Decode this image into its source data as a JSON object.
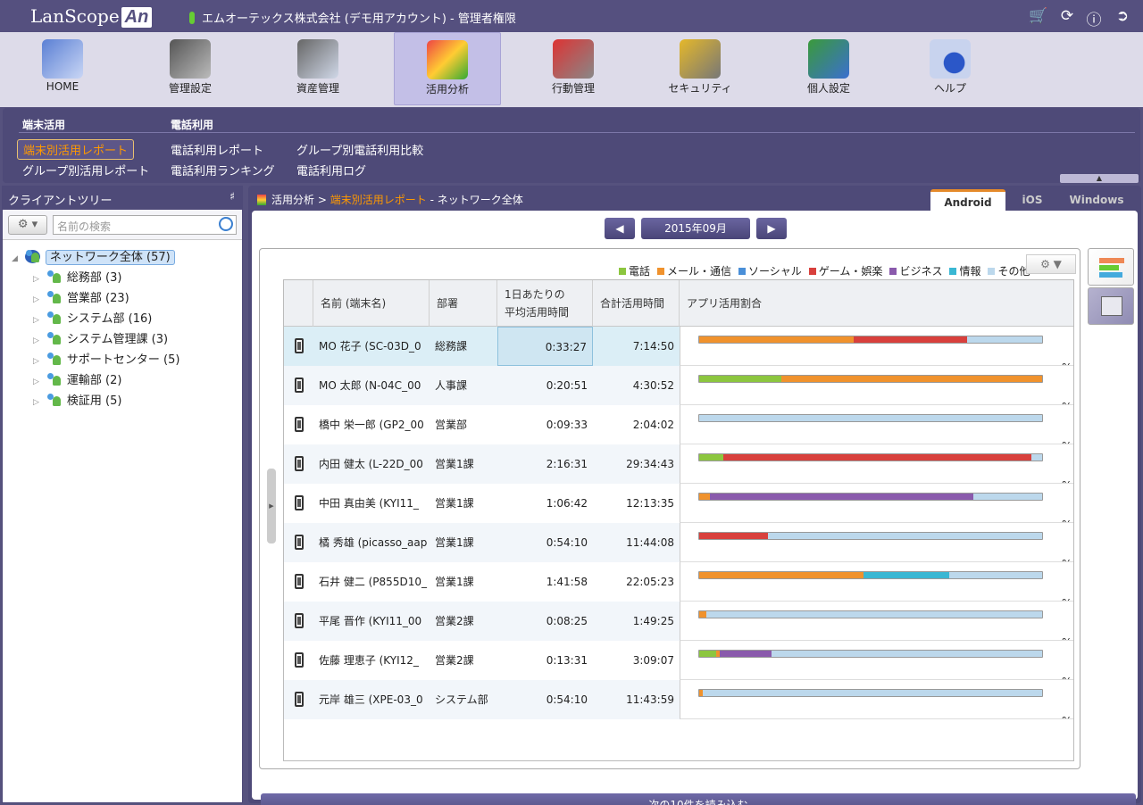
{
  "header": {
    "logo_text": "LanScope",
    "logo_badge": "An",
    "company": "エムオーテックス株式会社 (デモ用アカウント) - 管理者権限",
    "icons": [
      "cart-icon",
      "refresh-icon",
      "info-icon",
      "logout-icon"
    ]
  },
  "nav": [
    {
      "label": "HOME",
      "icon": "home-icon"
    },
    {
      "label": "管理設定",
      "icon": "settings-device-icon"
    },
    {
      "label": "資産管理",
      "icon": "asset-search-icon"
    },
    {
      "label": "活用分析",
      "icon": "analytics-icon",
      "active": true
    },
    {
      "label": "行動管理",
      "icon": "location-pin-icon"
    },
    {
      "label": "セキュリティ",
      "icon": "lock-icon"
    },
    {
      "label": "個人設定",
      "icon": "user-icon"
    },
    {
      "label": "ヘルプ",
      "icon": "help-icon"
    }
  ],
  "subnav": {
    "group1_title": "端末活用",
    "group1_links": [
      "端末別活用レポート",
      "グループ別活用レポート"
    ],
    "group2_title": "電話利用",
    "group2_links": [
      "電話利用レポート",
      "電話利用ランキング"
    ],
    "group3_links": [
      "グループ別電話利用比較",
      "電話利用ログ"
    ],
    "collapse_icon": "collapse-up-icon"
  },
  "tree": {
    "title": "クライアントツリー",
    "pin_icon": "pin-icon",
    "search_placeholder": "名前の検索",
    "root": "ネットワーク全体 (57)",
    "children": [
      "総務部 (3)",
      "営業部 (23)",
      "システム部 (16)",
      "システム管理課 (3)",
      "サポートセンター (5)",
      "運輸部 (2)",
      "検証用 (5)"
    ]
  },
  "breadcrumb": {
    "part1": "活用分析",
    "sep": ">",
    "current": "端末別活用レポート",
    "dash": "-",
    "scope": "ネットワーク全体"
  },
  "os_tabs": {
    "android": "Android",
    "ios": "iOS",
    "windows": "Windows",
    "active": "Android"
  },
  "month": {
    "prev_icon": "prev-month-icon",
    "label": "2015年09月",
    "next_icon": "next-month-icon"
  },
  "legend": [
    {
      "label": "電話",
      "color": "#8cc63f"
    },
    {
      "label": "メール・通信",
      "color": "#f0922d"
    },
    {
      "label": "ソーシャル",
      "color": "#4a8fd8"
    },
    {
      "label": "ゲーム・娯楽",
      "color": "#d8403c"
    },
    {
      "label": "ビジネス",
      "color": "#8a5aac"
    },
    {
      "label": "情報",
      "color": "#3ab7d3"
    },
    {
      "label": "その他",
      "color": "#bcd8ec"
    }
  ],
  "table": {
    "headers": {
      "name": "名前 (端末名)",
      "dept": "部署",
      "avg_line1": "1日あたりの",
      "avg_line2": "平均活用時間",
      "total": "合計活用時間",
      "ratio": "アプリ活用割合"
    },
    "axis_ticks": [
      "0",
      "10",
      "20",
      "30",
      "40",
      "50",
      "60",
      "70",
      "80",
      "90",
      "100"
    ],
    "percent_label": "%",
    "rows": [
      {
        "name": "MO 花子 (SC-03D_0",
        "dept": "総務課",
        "avg": "0:33:27",
        "total": "7:14:50",
        "ratio": [
          0,
          45,
          0,
          33,
          0,
          0,
          22
        ]
      },
      {
        "name": "MO 太郎 (N-04C_00",
        "dept": "人事課",
        "avg": "0:20:51",
        "total": "4:30:52",
        "ratio": [
          24,
          76,
          0,
          0,
          0,
          0,
          0
        ]
      },
      {
        "name": "橋中 栄一郎 (GP2_00",
        "dept": "営業部",
        "avg": "0:09:33",
        "total": "2:04:02",
        "ratio": [
          0,
          0,
          0,
          0,
          0,
          0,
          100
        ]
      },
      {
        "name": "内田 健太 (L-22D_00",
        "dept": "営業1課",
        "avg": "2:16:31",
        "total": "29:34:43",
        "ratio": [
          7,
          0,
          0,
          90,
          0,
          0,
          3
        ]
      },
      {
        "name": "中田 真由美 (KYI11_",
        "dept": "営業1課",
        "avg": "1:06:42",
        "total": "12:13:35",
        "ratio": [
          0,
          3,
          0,
          0,
          77,
          0,
          20
        ]
      },
      {
        "name": "橘 秀雄 (picasso_aap",
        "dept": "営業1課",
        "avg": "0:54:10",
        "total": "11:44:08",
        "ratio": [
          0,
          0,
          0,
          20,
          0,
          0,
          80
        ]
      },
      {
        "name": "石井 健二 (P855D10_",
        "dept": "営業1課",
        "avg": "1:41:58",
        "total": "22:05:23",
        "ratio": [
          0,
          48,
          0,
          0,
          0,
          25,
          27
        ]
      },
      {
        "name": "平尾 晋作 (KYI11_00",
        "dept": "営業2課",
        "avg": "0:08:25",
        "total": "1:49:25",
        "ratio": [
          0,
          2,
          0,
          0,
          0,
          0,
          98
        ]
      },
      {
        "name": "佐藤 理恵子 (KYI12_",
        "dept": "営業2課",
        "avg": "0:13:31",
        "total": "3:09:07",
        "ratio": [
          5,
          1,
          0,
          0,
          15,
          0,
          79
        ]
      },
      {
        "name": "元岸 雄三 (XPE-03_0",
        "dept": "システム部",
        "avg": "0:54:10",
        "total": "11:43:59",
        "ratio": [
          0,
          1,
          0,
          0,
          0,
          0,
          99
        ]
      }
    ]
  },
  "side_tabs": [
    "bar-chart-view-icon",
    "table-view-icon"
  ],
  "load_more": "次の10件を読み込む"
}
